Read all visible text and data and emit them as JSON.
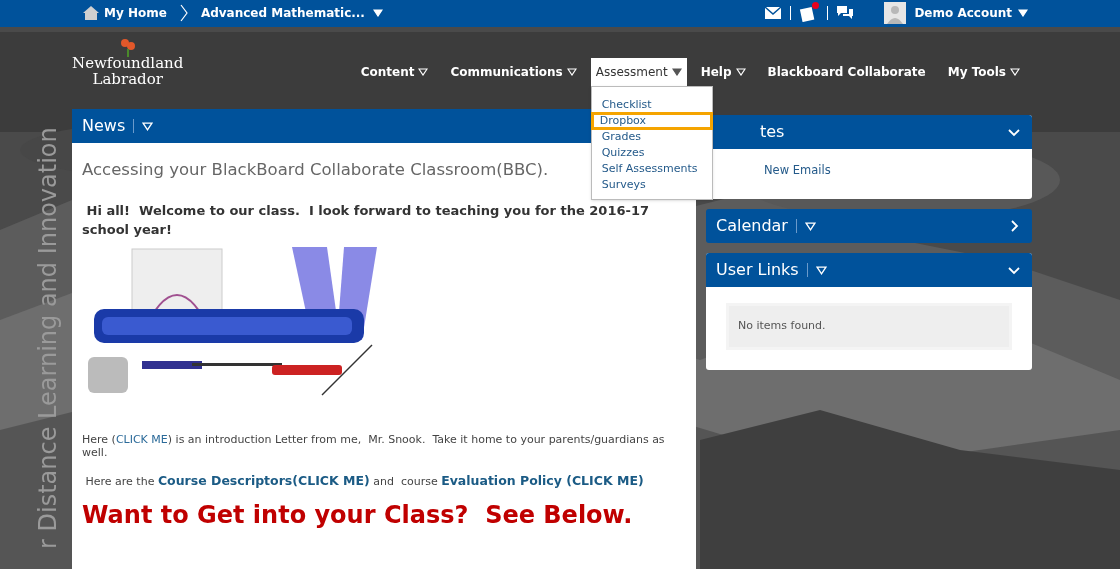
{
  "topbar": {
    "home": "My Home",
    "course": "Advanced Mathematic...",
    "notifications": [
      {
        "kind": "mail",
        "alert": false
      },
      {
        "kind": "updates",
        "alert": true
      },
      {
        "kind": "chat",
        "alert": false
      }
    ],
    "account": "Demo Account"
  },
  "logo": {
    "line1": "Newfoundland",
    "line2": "Labrador"
  },
  "banner_text": "r Distance Learning and Innovation",
  "nav": [
    {
      "label": "Content",
      "menu": true,
      "selected": false
    },
    {
      "label": "Communications",
      "menu": true,
      "selected": false
    },
    {
      "label": "Assessment",
      "menu": true,
      "selected": true
    },
    {
      "label": "Help",
      "menu": true,
      "selected": false
    },
    {
      "label": "Blackboard Collaborate",
      "menu": false,
      "selected": false
    },
    {
      "label": "My Tools",
      "menu": true,
      "selected": false
    }
  ],
  "dropdown": [
    {
      "label": "Checklist",
      "selected": false
    },
    {
      "label": "Dropbox",
      "selected": true
    },
    {
      "label": "Grades",
      "selected": false
    },
    {
      "label": "Quizzes",
      "selected": false
    },
    {
      "label": "Self Assessments",
      "selected": false
    },
    {
      "label": "Surveys",
      "selected": false
    }
  ],
  "news": {
    "title": "News",
    "heading": "Accessing your BlackBoard Collaborate Classroom(BBC).",
    "welcome": " Hi all!  Welcome to our class.  I look forward to teaching you for the 2016-17 school year!",
    "paragraphs": [
      [
        {
          "text": "Here (",
          "kind": "text"
        },
        {
          "text": "CLICK ME",
          "kind": "link"
        },
        {
          "text": ") is an introduction Letter from me,  Mr. Snook.  Take it home to your parents/guardians as well.",
          "kind": "text"
        }
      ],
      [
        {
          "text": " Here are the ",
          "kind": "text"
        },
        {
          "text": "Course Descriptors(CLICK ME)",
          "kind": "link"
        },
        {
          "text": " and  course ",
          "kind": "text"
        },
        {
          "text": "Evaluation Policy (CLICK ME)",
          "kind": "link"
        }
      ]
    ],
    "callout": "Want to Get into your Class?  See Below."
  },
  "widgets": [
    {
      "kind": "updates",
      "title": "tes",
      "expanded": true,
      "items": [
        "New Emails"
      ]
    },
    {
      "kind": "calendar",
      "title": "Calendar",
      "expanded": false,
      "menu": true
    },
    {
      "kind": "links",
      "title": "User Links",
      "expanded": true,
      "menu": true,
      "empty": "No items found."
    }
  ]
}
